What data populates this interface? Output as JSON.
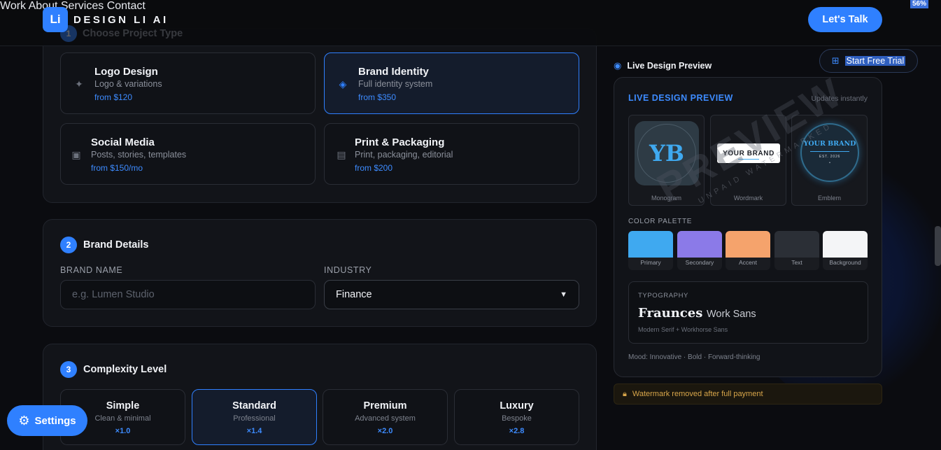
{
  "header": {
    "logo_mark": "Li",
    "brand": "DESIGN LI AI",
    "nav": [
      {
        "label": "Work"
      },
      {
        "label": "About"
      },
      {
        "label": "Services"
      },
      {
        "label": "Contact"
      }
    ],
    "cta": "Let's Talk",
    "zoom_badge": "56%"
  },
  "step1": {
    "num": "1",
    "title": "Choose Project Type",
    "options": [
      {
        "title": "Logo Design",
        "sub": "Logo & variations",
        "price": "from $120",
        "icon": "sparkle-icon",
        "selected": false
      },
      {
        "title": "Brand Identity",
        "sub": "Full identity system",
        "price": "from $350",
        "icon": "diamond-icon",
        "selected": true
      },
      {
        "title": "Social Media",
        "sub": "Posts, stories, templates",
        "price": "from $150/mo",
        "icon": "image-icon",
        "selected": false
      },
      {
        "title": "Print & Packaging",
        "sub": "Print, packaging, editorial",
        "price": "from $200",
        "icon": "document-icon",
        "selected": false
      }
    ]
  },
  "step2": {
    "num": "2",
    "title": "Brand Details",
    "brand_name_label": "BRAND NAME",
    "brand_name_placeholder": "e.g. Lumen Studio",
    "brand_name_value": "",
    "industry_label": "INDUSTRY",
    "industry_value": "Finance"
  },
  "step3": {
    "num": "3",
    "title": "Complexity Level",
    "levels": [
      {
        "name": "Simple",
        "desc": "Clean & minimal",
        "mult": "×1.0",
        "selected": false
      },
      {
        "name": "Standard",
        "desc": "Professional",
        "mult": "×1.4",
        "selected": true
      },
      {
        "name": "Premium",
        "desc": "Advanced system",
        "mult": "×2.0",
        "selected": false
      },
      {
        "name": "Luxury",
        "desc": "Bespoke",
        "mult": "×2.8",
        "selected": false
      }
    ]
  },
  "settings_label": "Settings",
  "preview": {
    "label": "Live Design Preview",
    "trial": "Start Free Trial",
    "header": "LIVE DESIGN PREVIEW",
    "updates": "Updates instantly",
    "tiles": [
      {
        "caption": "Monogram",
        "mark": "YB"
      },
      {
        "caption": "Wordmark",
        "mark": "YOUR BRAND"
      },
      {
        "caption": "Emblem",
        "mark": "YOUR BRAND",
        "sub": "EST. 2026",
        "dot": "•"
      }
    ],
    "palette_label": "COLOR PALETTE",
    "palette": [
      {
        "name": "Primary",
        "color": "#3fa9f0"
      },
      {
        "name": "Secondary",
        "color": "#8b7ae8"
      },
      {
        "name": "Accent",
        "color": "#f5a36c"
      },
      {
        "name": "Text",
        "color": "#2b2f36"
      },
      {
        "name": "Background",
        "color": "#f4f5f7"
      }
    ],
    "typography_label": "TYPOGRAPHY",
    "font_serif": "Fraunces",
    "font_sans": "Work Sans",
    "font_hint": "Modern Serif + Workhorse Sans",
    "mood": "Mood: Innovative · Bold · Forward-thinking",
    "watermark_big": "PREVIEW",
    "watermark_small": "UNPAID WATERMARKED"
  },
  "watermark_note": "Watermark removed after full payment",
  "colors": {
    "accent": "#2f80ff",
    "bg": "#0b0c10",
    "card": "#121419"
  }
}
